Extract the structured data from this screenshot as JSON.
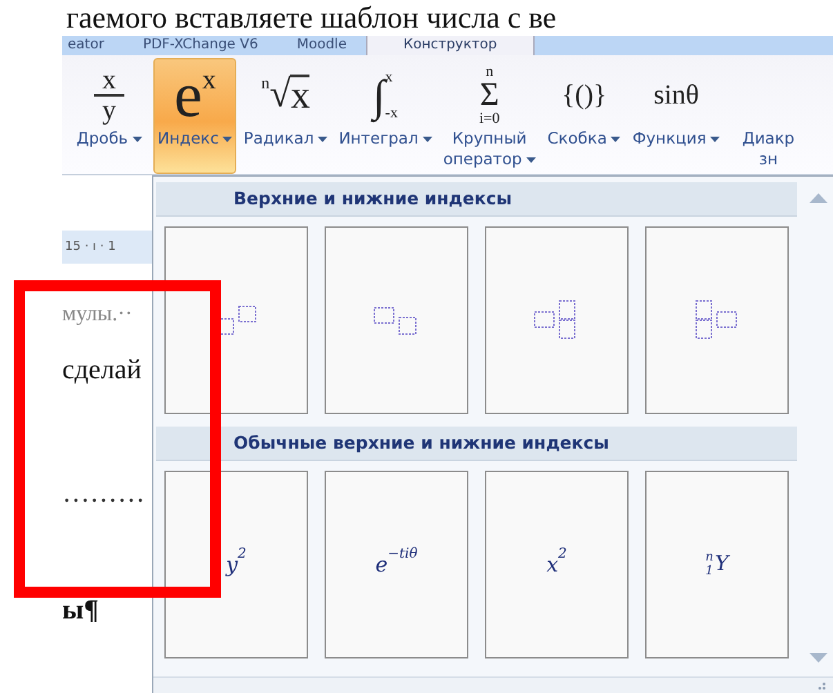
{
  "document_heading": "гаемого вставляете шаблон числа с ве",
  "tabs": [
    {
      "label": "eator",
      "selected": false
    },
    {
      "label": "PDF-XChange V6",
      "selected": false
    },
    {
      "label": "Moodle",
      "selected": false
    },
    {
      "label": "Конструктор",
      "selected": true
    }
  ],
  "ribbon": {
    "buttons": [
      {
        "label": [
          "Дробь"
        ],
        "selected": false,
        "symbol": {
          "kind": "fraction",
          "num": "x",
          "den": "y"
        }
      },
      {
        "label": [
          "Индекс"
        ],
        "selected": true,
        "symbol": {
          "kind": "script",
          "base": "e",
          "sup": "x"
        }
      },
      {
        "label": [
          "Радикал"
        ],
        "selected": false,
        "symbol": {
          "kind": "radical",
          "index": "n",
          "sign": "√",
          "base": "x"
        }
      },
      {
        "label": [
          "Интеграл"
        ],
        "selected": false,
        "symbol": {
          "kind": "limits",
          "sign": "∫",
          "upper": "x",
          "lower": "-x"
        }
      },
      {
        "label": [
          "Крупный",
          "оператор"
        ],
        "selected": false,
        "symbol": {
          "kind": "stack",
          "sign": "Σ",
          "upper": "n",
          "lower": "i=0"
        }
      },
      {
        "label": [
          "Скобка"
        ],
        "selected": false,
        "symbol": {
          "kind": "text",
          "text": "{()}"
        }
      },
      {
        "label": [
          "Функция"
        ],
        "selected": false,
        "symbol": {
          "kind": "text",
          "text": "sinθ"
        }
      },
      {
        "label": [
          "Диакр",
          "зн"
        ],
        "selected": false
      }
    ]
  },
  "ruler": {
    "text": "15 · ı · 1"
  },
  "document_lines": [
    {
      "text": "мулы.··",
      "kind": "faint"
    },
    {
      "text": "сделай",
      "kind": "normal"
    },
    {
      "text": "·········",
      "kind": "normal"
    },
    {
      "text": "ы¶",
      "kind": "bold"
    }
  ],
  "gallery": {
    "sections": [
      {
        "title": "Верхние и нижние индексы",
        "items": [
          {
            "kind": "sup"
          },
          {
            "kind": "sub"
          },
          {
            "kind": "subsup"
          },
          {
            "kind": "presubsup"
          }
        ]
      },
      {
        "title": "Обычные верхние и нижние индексы",
        "items": [
          {
            "kind": "formula",
            "base": "y",
            "sup": "2"
          },
          {
            "kind": "formula",
            "base": "e",
            "sup": "−tiθ"
          },
          {
            "kind": "formula",
            "base": "x",
            "sup": "2"
          },
          {
            "kind": "formula",
            "base": "Y",
            "pre_sup": "n",
            "pre_sub": "1"
          }
        ]
      }
    ]
  }
}
